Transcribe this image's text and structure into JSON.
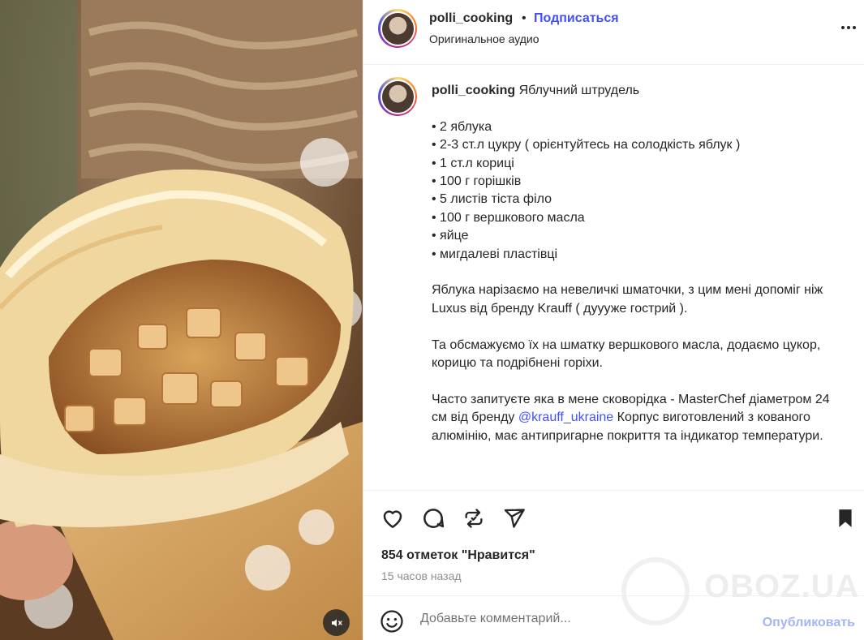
{
  "header": {
    "username": "polli_cooking",
    "separator": "•",
    "subscribe_label": "Подписаться",
    "audio_label": "Оригинальное аудио",
    "more_icon": "more-horizontal-icon"
  },
  "caption": {
    "username": "polli_cooking",
    "title": "Яблучний штрудель",
    "ingredients": [
      "• 2 яблука",
      "• 2-3 ст.л цукру ( орієнтуйтесь на солодкість яблук )",
      "• 1 ст.л кориці",
      "• 100 г горішків",
      "• 5 листів тіста філо",
      "• 100 г вершкового масла",
      "• яйце",
      "• мигдалеві пластівці"
    ],
    "paragraph1": "Яблука нарізаємо на невеличкі шматочки, з цим мені допоміг ніж Luxus від бренду Krauff ( дуууже гострий ).",
    "paragraph2": "Та обсмажуємо їх на шматку вершкового масла, додаємо цукор, корицю та подрібнені горіхи.",
    "paragraph3_before": "Часто запитуєте яка в мене сковорідка - MasterChef діаметром 24 см від бренду ",
    "paragraph3_mention": "@krauff_ukraine",
    "paragraph3_after": " Корпус виготовлений з кованого алюмінію, має антипригарне покриття та індикатор температури."
  },
  "actions": {
    "like_icon": "heart-icon",
    "comment_icon": "comment-icon",
    "repost_icon": "repost-icon",
    "share_icon": "send-icon",
    "save_icon": "bookmark-icon",
    "likes_text": "854 отметок \"Нравится\"",
    "time_text": "15 часов назад"
  },
  "watermark": "OBOZ.UA",
  "comment": {
    "placeholder": "Добавьте комментарий...",
    "publish_label": "Опубликовать"
  },
  "colors": {
    "accent": "#4150f7",
    "publish_disabled": "#a5b4f7",
    "secondary_text": "#8e8e8e"
  }
}
